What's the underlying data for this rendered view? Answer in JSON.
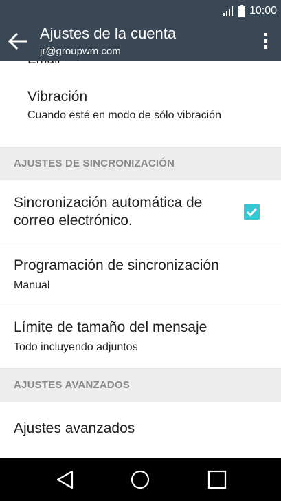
{
  "status_bar": {
    "time": "10:00"
  },
  "app_bar": {
    "title": "Ajustes de la cuenta",
    "subtitle": "jr@groupwm.com"
  },
  "list": {
    "partial_item_title": "Email",
    "vibration": {
      "title": "Vibración",
      "subtitle": "Cuando esté en modo de sólo vibración"
    },
    "sync_header": "AJUSTES DE SINCRONIZACIÓN",
    "auto_sync": {
      "title": "Sincronización automática de correo electrónico.",
      "checked": true
    },
    "sync_schedule": {
      "title": "Programación de sincronización",
      "subtitle": "Manual"
    },
    "size_limit": {
      "title": "Límite de tamaño del mensaje",
      "subtitle": "Todo incluyendo adjuntos"
    },
    "advanced_header": "AJUSTES AVANZADOS",
    "advanced": {
      "title": "Ajustes avanzados"
    }
  },
  "colors": {
    "app_bar": "#3a4755",
    "checkbox": "#35c6d4",
    "section_header_bg": "#ededed",
    "section_header_text": "#8a8a8a",
    "nav_bar": "#000000"
  },
  "icons": {
    "back": "arrow-left-icon",
    "more": "more-vert-icon",
    "signal": "signal-icon",
    "battery": "battery-icon",
    "nav_back": "triangle-back-icon",
    "nav_home": "circle-home-icon",
    "nav_recents": "square-recents-icon"
  }
}
